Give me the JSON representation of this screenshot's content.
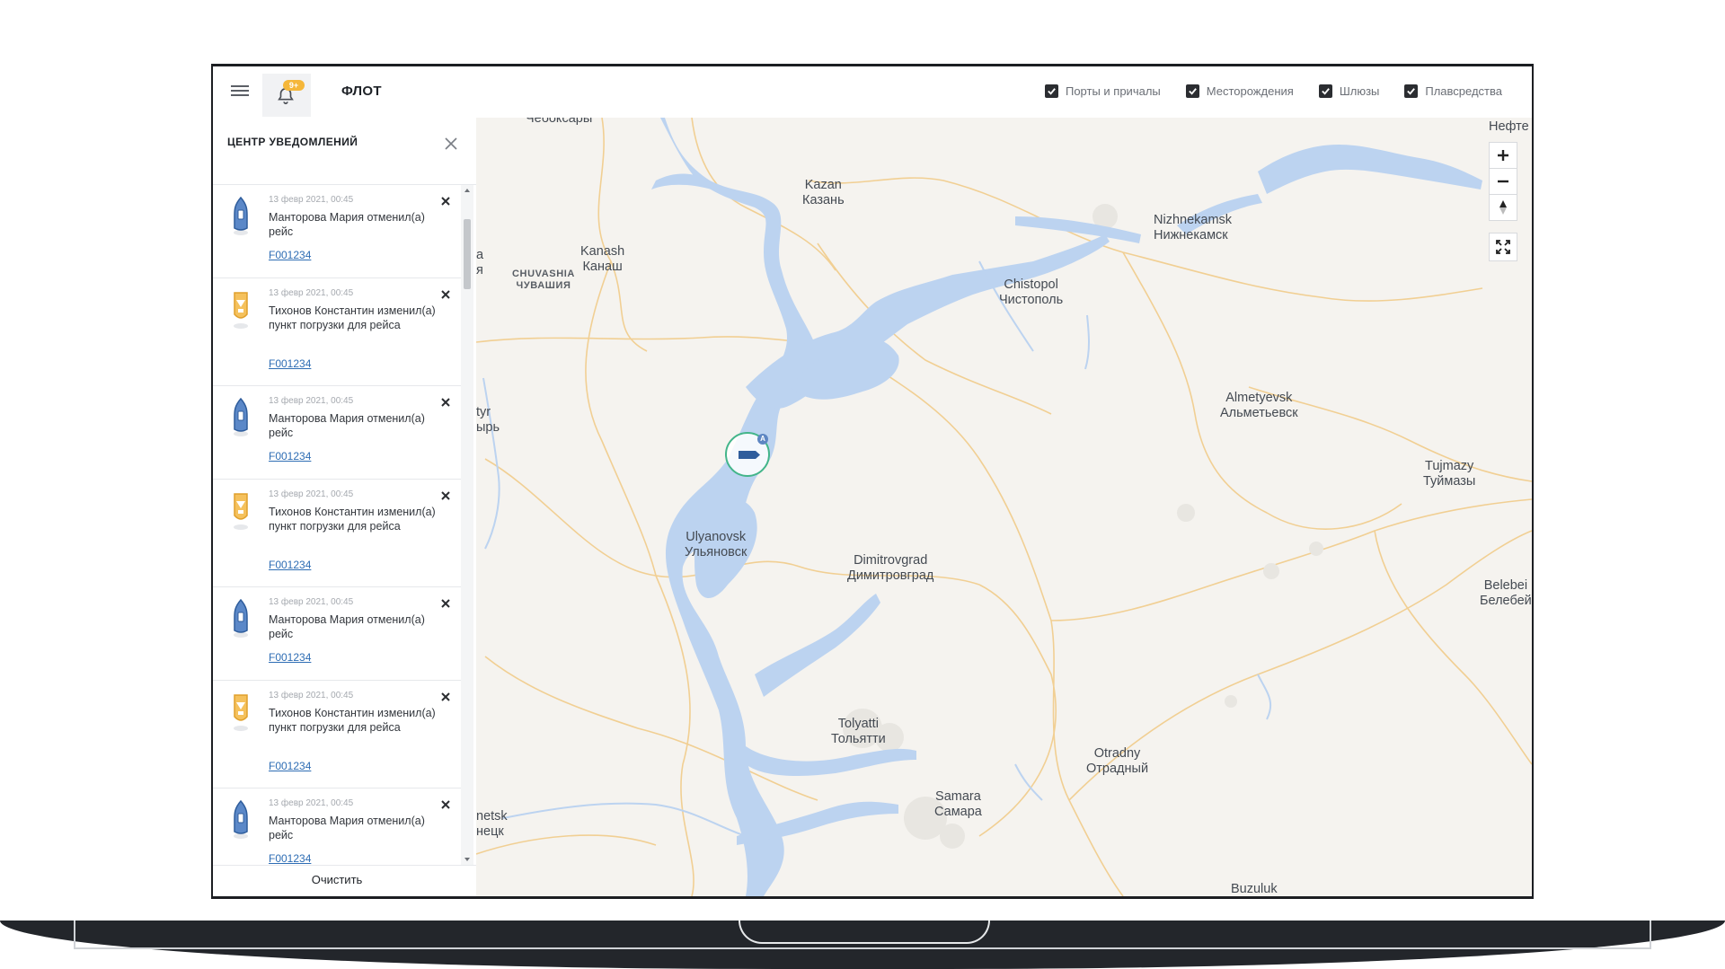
{
  "header": {
    "title": "ФЛОТ",
    "badge": "9+",
    "filters": [
      {
        "label": "Порты и причалы",
        "checked": true
      },
      {
        "label": "Месторождения",
        "checked": true
      },
      {
        "label": "Шлюзы",
        "checked": true
      },
      {
        "label": "Плавсредства",
        "checked": true
      }
    ]
  },
  "sidebar": {
    "title": "ЦЕНТР УВЕДОМЛЕНИЙ",
    "clear_label": "Очистить",
    "items": [
      {
        "icon": "blue-ship-icon",
        "time": "13 февр 2021, 00:45",
        "text": "Манторова Мария отменил(а) рейс",
        "link": "F001234"
      },
      {
        "icon": "orange-ship-icon",
        "time": "13 февр 2021, 00:45",
        "text": "Тихонов Константин изменил(а) пункт погрузки для рейса",
        "link": "F001234"
      },
      {
        "icon": "blue-ship-icon",
        "time": "13 февр 2021, 00:45",
        "text": "Манторова Мария отменил(а) рейс",
        "link": "F001234"
      },
      {
        "icon": "orange-ship-icon",
        "time": "13 февр 2021, 00:45",
        "text": "Тихонов Константин изменил(а) пункт погрузки для рейса",
        "link": "F001234"
      },
      {
        "icon": "blue-ship-icon",
        "time": "13 февр 2021, 00:45",
        "text": "Манторова Мария отменил(а) рейс",
        "link": "F001234"
      },
      {
        "icon": "orange-ship-icon",
        "time": "13 февр 2021, 00:45",
        "text": "Тихонов Константин изменил(а) пункт погрузки для рейса",
        "link": "F001234"
      },
      {
        "icon": "blue-ship-icon",
        "time": "13 февр 2021, 00:45",
        "text": "Манторова Мария отменил(а) рейс",
        "link": "F001234"
      }
    ]
  },
  "map": {
    "labels": {
      "cheboksary": "Чебоксары",
      "kazan": "Kazan\nКазань",
      "kanash": "Kanash\nКанаш",
      "chuvashia": "CHUVASHIA\nЧУВАШИЯ",
      "nizhnekamsk": "Nizhnekamsk\nНижнекамск",
      "chistopol": "Chistopol\nЧистополь",
      "almetyevsk": "Almetyevsk\nАльметьевск",
      "tujmazy": "Tujmazy\nТуймазы",
      "ulyanovsk": "Ulyanovsk\nУльяновск",
      "dimitrovgrad": "Dimitrovgrad\nДимитровград",
      "belebei": "Belebei\nБелебей",
      "tolyatti": "Tolyatti\nТольятти",
      "samara": "Samara\nСамара",
      "otradny": "Otradny\nОтрадный",
      "buzuluk": "Buzuluk",
      "neftekamsk": "Нефте",
      "edge_a": "a\nя",
      "edge_tyr": "tyr\nырь",
      "edge_netsk": "netsk\nнецк"
    },
    "marker_badge": "A",
    "colors": {
      "water": "#bcd3f0",
      "roads": "#f1cf93",
      "land": "#f5f3ef",
      "marker": "#43b58a",
      "ship_blue": "#2f5d9c",
      "ship_orange": "#f0b13a"
    }
  }
}
